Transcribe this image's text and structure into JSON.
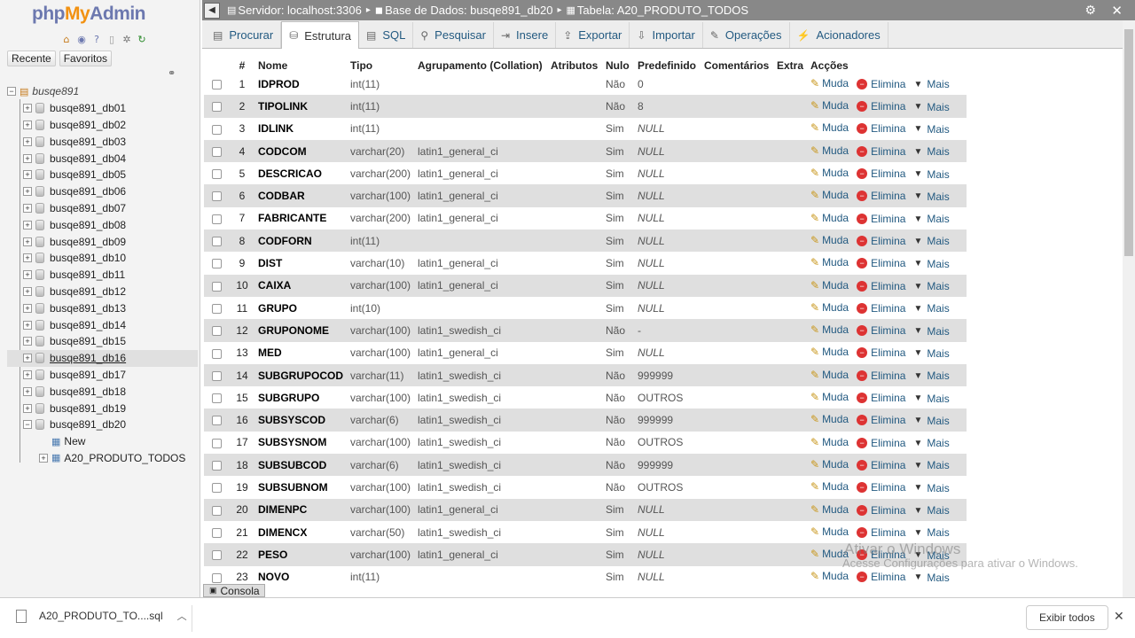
{
  "nav": {
    "logo": {
      "php": "php",
      "my": "My",
      "admin": "Admin"
    },
    "tabs": [
      "Recente",
      "Favoritos"
    ],
    "root": "busqe891",
    "databases": [
      "busqe891_db01",
      "busqe891_db02",
      "busqe891_db03",
      "busqe891_db04",
      "busqe891_db05",
      "busqe891_db06",
      "busqe891_db07",
      "busqe891_db08",
      "busqe891_db09",
      "busqe891_db10",
      "busqe891_db11",
      "busqe891_db12",
      "busqe891_db13",
      "busqe891_db14",
      "busqe891_db15",
      "busqe891_db16",
      "busqe891_db17",
      "busqe891_db18",
      "busqe891_db19",
      "busqe891_db20"
    ],
    "highlighted": "busqe891_db16",
    "expanded": "busqe891_db20",
    "children": {
      "new": "New",
      "table": "A20_PRODUTO_TODOS"
    }
  },
  "breadcrumb": {
    "server": "Servidor: localhost:3306",
    "database": "Base de Dados: busqe891_db20",
    "table": "Tabela: A20_PRODUTO_TODOS"
  },
  "tabs": [
    {
      "label": "Procurar",
      "icon": "browse-icon"
    },
    {
      "label": "Estrutura",
      "icon": "structure-icon",
      "active": true
    },
    {
      "label": "SQL",
      "icon": "sql-icon"
    },
    {
      "label": "Pesquisar",
      "icon": "search-icon"
    },
    {
      "label": "Insere",
      "icon": "insert-icon"
    },
    {
      "label": "Exportar",
      "icon": "export-icon"
    },
    {
      "label": "Importar",
      "icon": "import-icon"
    },
    {
      "label": "Operações",
      "icon": "wrench-icon"
    },
    {
      "label": "Acionadores",
      "icon": "triggers-icon"
    }
  ],
  "table": {
    "headers": [
      "",
      "#",
      "Nome",
      "Tipo",
      "Agrupamento (Collation)",
      "Atributos",
      "Nulo",
      "Predefinido",
      "Comentários",
      "Extra",
      "Acções"
    ],
    "actions": {
      "edit": "Muda",
      "drop": "Elimina",
      "more": "Mais"
    },
    "rows": [
      {
        "n": "1",
        "name": "IDPROD",
        "type": "int(11)",
        "coll": "",
        "nulo": "Não",
        "def": "0"
      },
      {
        "n": "2",
        "name": "TIPOLINK",
        "type": "int(11)",
        "coll": "",
        "nulo": "Não",
        "def": "8"
      },
      {
        "n": "3",
        "name": "IDLINK",
        "type": "int(11)",
        "coll": "",
        "nulo": "Sim",
        "def": "NULL"
      },
      {
        "n": "4",
        "name": "CODCOM",
        "type": "varchar(20)",
        "coll": "latin1_general_ci",
        "nulo": "Sim",
        "def": "NULL"
      },
      {
        "n": "5",
        "name": "DESCRICAO",
        "type": "varchar(200)",
        "coll": "latin1_general_ci",
        "nulo": "Sim",
        "def": "NULL"
      },
      {
        "n": "6",
        "name": "CODBAR",
        "type": "varchar(100)",
        "coll": "latin1_general_ci",
        "nulo": "Sim",
        "def": "NULL"
      },
      {
        "n": "7",
        "name": "FABRICANTE",
        "type": "varchar(200)",
        "coll": "latin1_general_ci",
        "nulo": "Sim",
        "def": "NULL"
      },
      {
        "n": "8",
        "name": "CODFORN",
        "type": "int(11)",
        "coll": "",
        "nulo": "Sim",
        "def": "NULL"
      },
      {
        "n": "9",
        "name": "DIST",
        "type": "varchar(10)",
        "coll": "latin1_general_ci",
        "nulo": "Sim",
        "def": "NULL"
      },
      {
        "n": "10",
        "name": "CAIXA",
        "type": "varchar(100)",
        "coll": "latin1_general_ci",
        "nulo": "Sim",
        "def": "NULL"
      },
      {
        "n": "11",
        "name": "GRUPO",
        "type": "int(10)",
        "coll": "",
        "nulo": "Sim",
        "def": "NULL"
      },
      {
        "n": "12",
        "name": "GRUPONOME",
        "type": "varchar(100)",
        "coll": "latin1_swedish_ci",
        "nulo": "Não",
        "def": "-"
      },
      {
        "n": "13",
        "name": "MED",
        "type": "varchar(100)",
        "coll": "latin1_general_ci",
        "nulo": "Sim",
        "def": "NULL"
      },
      {
        "n": "14",
        "name": "SUBGRUPOCOD",
        "type": "varchar(11)",
        "coll": "latin1_swedish_ci",
        "nulo": "Não",
        "def": "999999"
      },
      {
        "n": "15",
        "name": "SUBGRUPO",
        "type": "varchar(100)",
        "coll": "latin1_swedish_ci",
        "nulo": "Não",
        "def": "OUTROS"
      },
      {
        "n": "16",
        "name": "SUBSYSCOD",
        "type": "varchar(6)",
        "coll": "latin1_swedish_ci",
        "nulo": "Não",
        "def": "999999"
      },
      {
        "n": "17",
        "name": "SUBSYSNOM",
        "type": "varchar(100)",
        "coll": "latin1_swedish_ci",
        "nulo": "Não",
        "def": "OUTROS"
      },
      {
        "n": "18",
        "name": "SUBSUBCOD",
        "type": "varchar(6)",
        "coll": "latin1_swedish_ci",
        "nulo": "Não",
        "def": "999999"
      },
      {
        "n": "19",
        "name": "SUBSUBNOM",
        "type": "varchar(100)",
        "coll": "latin1_swedish_ci",
        "nulo": "Não",
        "def": "OUTROS"
      },
      {
        "n": "20",
        "name": "DIMENPC",
        "type": "varchar(100)",
        "coll": "latin1_general_ci",
        "nulo": "Sim",
        "def": "NULL"
      },
      {
        "n": "21",
        "name": "DIMENCX",
        "type": "varchar(50)",
        "coll": "latin1_swedish_ci",
        "nulo": "Sim",
        "def": "NULL"
      },
      {
        "n": "22",
        "name": "PESO",
        "type": "varchar(100)",
        "coll": "latin1_general_ci",
        "nulo": "Sim",
        "def": "NULL"
      },
      {
        "n": "23",
        "name": "NOVO",
        "type": "int(11)",
        "coll": "",
        "nulo": "Sim",
        "def": "NULL"
      }
    ]
  },
  "consola": "Consola",
  "download": {
    "file": "A20_PRODUTO_TO....sql",
    "show_all": "Exibir todos"
  },
  "watermark": {
    "line1": "Ativar o Windows",
    "line2": "Acesse Configurações para ativar o Windows."
  },
  "colors": {
    "accent": "#235a81",
    "topbar": "#888888",
    "stripe": "#dfdfdf"
  }
}
